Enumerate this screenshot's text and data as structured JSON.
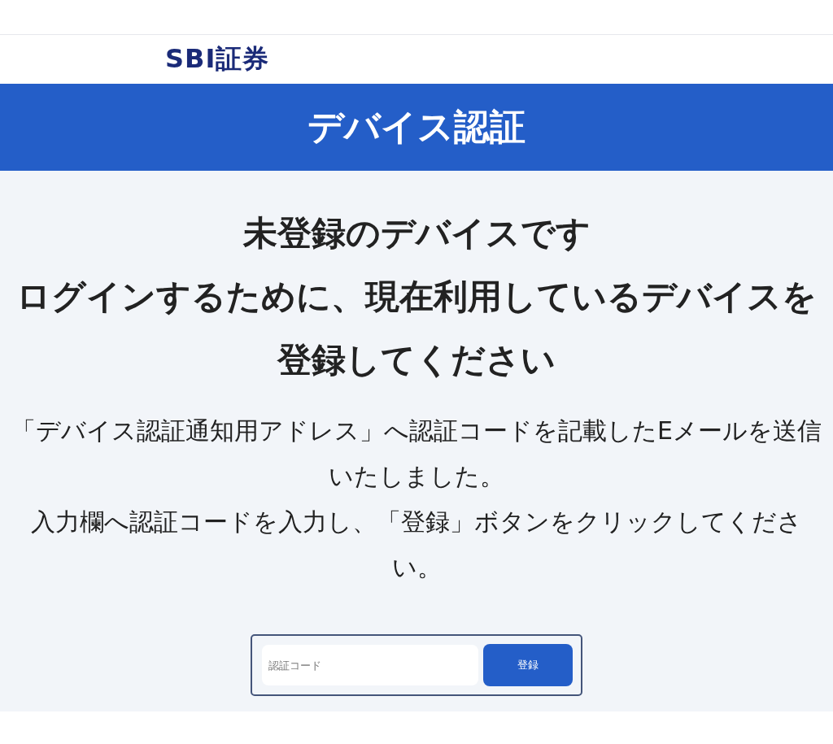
{
  "header": {
    "logo": "SBI証券"
  },
  "banner": {
    "title": "デバイス認証"
  },
  "heading": [
    "未登録のデバイスです",
    "ログインするために、現在利用しているデバイスを登録してください"
  ],
  "message": [
    "「デバイス認証通知用アドレス」へ認証コードを記載したEメールを送信いたしました。",
    "入力欄へ認証コードを入力し、「登録」ボタンをクリックしてください。"
  ],
  "form": {
    "code_field": {
      "placeholder": "認証コード"
    },
    "submit_button": "登録"
  }
}
